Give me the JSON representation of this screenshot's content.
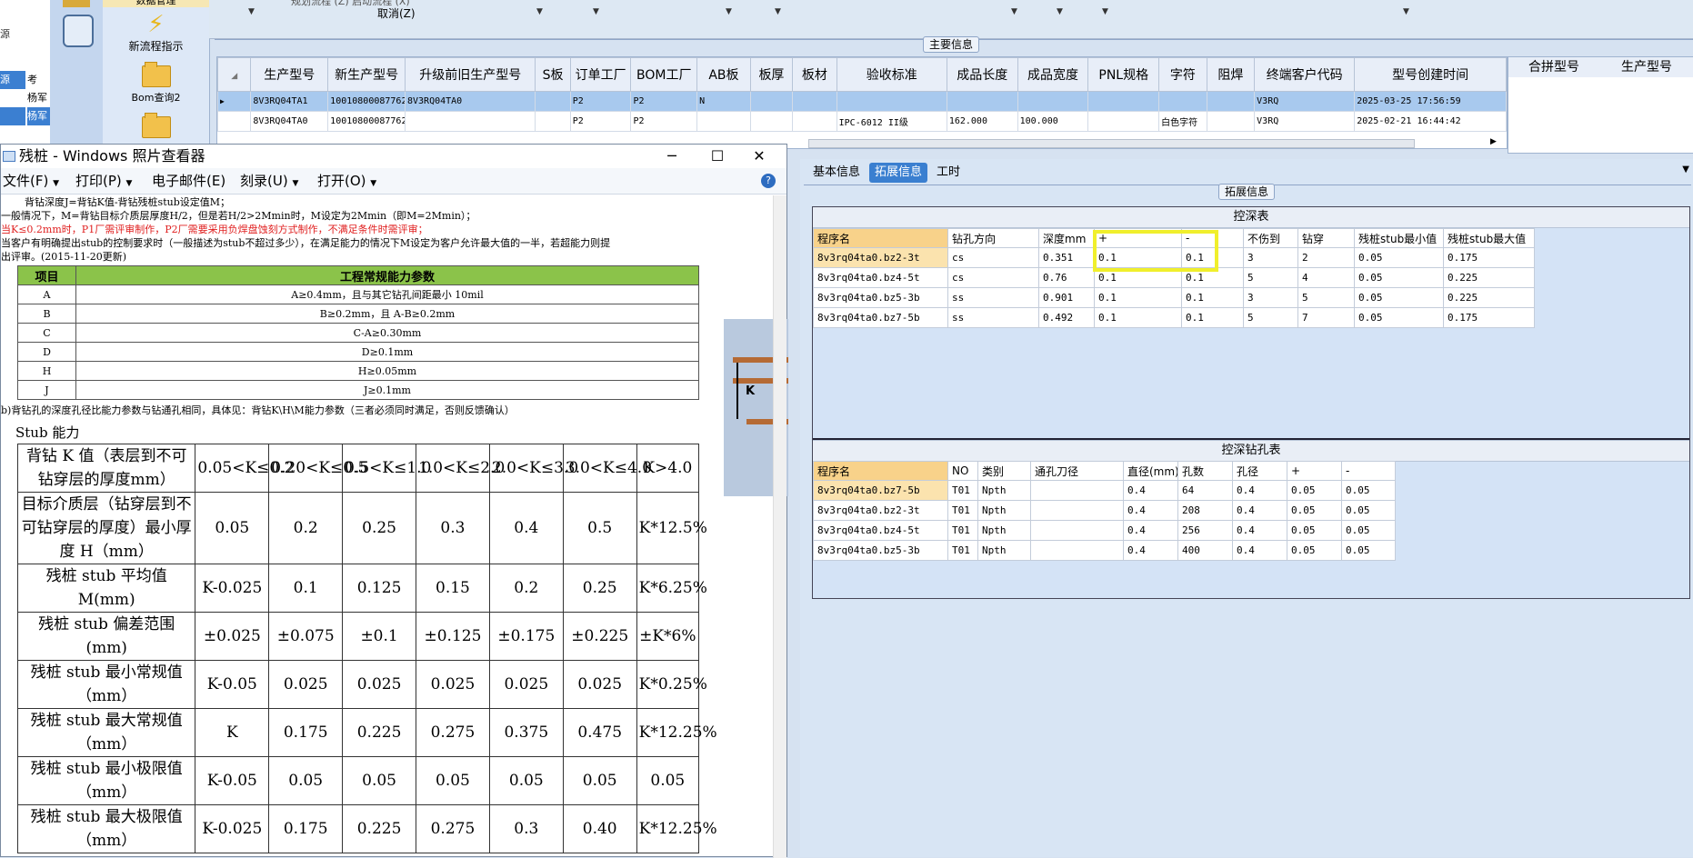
{
  "left_panel": {
    "rows": [
      "源",
      "考",
      "杨军",
      "杨军"
    ]
  },
  "launcher": {
    "items": [
      "数据管理",
      "新流程指示",
      "Bom查询2"
    ]
  },
  "topbar": {
    "cancel": "取消(Z)",
    "hidden_labels": "规划流程 (Z)    启动流程 (X)"
  },
  "main_info": {
    "group_title": "主要信息",
    "columns": [
      "生产型号",
      "新生产型号",
      "升级前旧生产型号",
      "S板",
      "订单工厂",
      "BOM工厂",
      "AB板",
      "板厚",
      "板材",
      "验收标准",
      "成品长度",
      "成品宽度",
      "PNL规格",
      "字符",
      "阻焊",
      "终端客户代码",
      "型号创建时间"
    ],
    "rows": [
      [
        "8V3RQ04TA1",
        "10010800087762",
        "8V3RQ04TA0",
        "",
        "P2",
        "P2",
        "N",
        "",
        "",
        "",
        "",
        "",
        "",
        "",
        "",
        "V3RQ",
        "2025-03-25 17:56:59"
      ],
      [
        "8V3RQ04TA0",
        "10010800087762",
        "",
        "",
        "P2",
        "P2",
        "",
        "",
        "",
        "IPC-6012 II级",
        "162.000",
        "100.000",
        "",
        "白色字符",
        "",
        "V3RQ",
        "2025-02-21 16:44:42"
      ]
    ],
    "side_columns": [
      "合拼型号",
      "生产型号"
    ]
  },
  "viewer": {
    "title": "残桩 - Windows 照片查看器",
    "menu": [
      "文件(F)",
      "打印(P)",
      "电子邮件(E)",
      "刻录(U)",
      "打开(O)"
    ],
    "notes": [
      "背钻深度J=背钻K值-背钻残桩stub设定值M；",
      "一般情况下，M=背钻目标介质层厚度H/2，但是若H/2>2Mmin时，M设定为2Mmin（即M=2Mmin）；",
      "当K≤0.2mm时，P1厂需评审制作，P2厂需要采用负焊盘蚀刻方式制作，不满足条件时需评审；",
      "当客户有明确提出stub的控制要求时（一般描述为stub不超过多少），在满足能力的情况下M设定为客户允许最大值的一半，若超能力则提",
      "出评审。(2015-11-20更新)"
    ],
    "param_table": {
      "headers": [
        "项目",
        "工程常规能力参数"
      ],
      "rows": [
        [
          "A",
          "A≥0.4mm，且与其它钻孔间距最小 10mil"
        ],
        [
          "B",
          "B≥0.2mm，且 A-B≥0.2mm"
        ],
        [
          "C",
          "C-A≥0.30mm"
        ],
        [
          "D",
          "D≥0.1mm"
        ],
        [
          "H",
          "H≥0.05mm"
        ],
        [
          "J",
          "J≥0.1mm"
        ]
      ]
    },
    "note_b": "b)背钻孔的深度孔径比能力参数与钻通孔相同，具体见：背钻K\\H\\M能力参数（三者必须同时满足，否则反馈确认）",
    "stub_title": "Stub 能力",
    "k_label": "K",
    "stub_table": [
      [
        "背钻 K 值（表层到不可钻穿层的厚度mm）",
        "0.05<K≤0.2",
        "0.20<K≤0.5",
        "0.5<K≤1.0",
        "1.0<K≤2.0",
        "2.0<K≤3.0",
        "3.0<K≤4.0",
        "K>4.0"
      ],
      [
        "目标介质层（钻穿层到不可钻穿层的厚度）最小厚度 H（mm）",
        "0.05",
        "0.2",
        "0.25",
        "0.3",
        "0.4",
        "0.5",
        "K*12.5%"
      ],
      [
        "残桩 stub 平均值 M(mm)",
        "K-0.025",
        "0.1",
        "0.125",
        "0.15",
        "0.2",
        "0.25",
        "K*6.25%"
      ],
      [
        "残桩 stub 偏差范围(mm)",
        "±0.025",
        "±0.075",
        "±0.1",
        "±0.125",
        "±0.175",
        "±0.225",
        "±K*6%"
      ],
      [
        "残桩 stub 最小常规值（mm）",
        "K-0.05",
        "0.025",
        "0.025",
        "0.025",
        "0.025",
        "0.025",
        "K*0.25%"
      ],
      [
        "残桩 stub 最大常规值（mm）",
        "K",
        "0.175",
        "0.225",
        "0.275",
        "0.375",
        "0.475",
        "K*12.25%"
      ],
      [
        "残桩 stub 最小极限值（mm）",
        "K-0.05",
        "0.05",
        "0.05",
        "0.05",
        "0.05",
        "0.05",
        "0.05"
      ],
      [
        "残桩 stub 最大极限值（mm）",
        "K-0.025",
        "0.175",
        "0.225",
        "0.275",
        "0.3",
        "0.40",
        "K*12.25%"
      ]
    ]
  },
  "tabs": [
    "基本信息",
    "拓展信息",
    "工时"
  ],
  "ext": {
    "group_title": "拓展信息",
    "depth_table": {
      "title": "控深表",
      "columns": [
        "程序名",
        "钻孔方向",
        "深度mm",
        "+",
        "-",
        "不伤到",
        "钻穿",
        "残桩stub最小值",
        "残桩stub最大值"
      ],
      "rows": [
        [
          "8v3rq04ta0.bz2-3t",
          "cs",
          "0.351",
          "0.1",
          "0.1",
          "3",
          "2",
          "0.05",
          "0.175"
        ],
        [
          "8v3rq04ta0.bz4-5t",
          "cs",
          "0.76",
          "0.1",
          "0.1",
          "5",
          "4",
          "0.05",
          "0.225"
        ],
        [
          "8v3rq04ta0.bz5-3b",
          "ss",
          "0.901",
          "0.1",
          "0.1",
          "3",
          "5",
          "0.05",
          "0.225"
        ],
        [
          "8v3rq04ta0.bz7-5b",
          "ss",
          "0.492",
          "0.1",
          "0.1",
          "5",
          "7",
          "0.05",
          "0.175"
        ]
      ]
    },
    "hole_table": {
      "title": "控深钻孔表",
      "columns": [
        "程序名",
        "NO",
        "类别",
        "通孔刀径",
        "直径(mm)",
        "孔数",
        "孔径",
        "+",
        "-"
      ],
      "rows": [
        [
          "8v3rq04ta0.bz7-5b",
          "T01",
          "Npth",
          "",
          "0.4",
          "64",
          "0.4",
          "0.05",
          "0.05"
        ],
        [
          "8v3rq04ta0.bz2-3t",
          "T01",
          "Npth",
          "",
          "0.4",
          "208",
          "0.4",
          "0.05",
          "0.05"
        ],
        [
          "8v3rq04ta0.bz4-5t",
          "T01",
          "Npth",
          "",
          "0.4",
          "256",
          "0.4",
          "0.05",
          "0.05"
        ],
        [
          "8v3rq04ta0.bz5-3b",
          "T01",
          "Npth",
          "",
          "0.4",
          "400",
          "0.4",
          "0.05",
          "0.05"
        ]
      ]
    }
  },
  "colors": {
    "highlight": "#f0ef2c",
    "tab_active": "#3a7fd0",
    "selected_row": "#a8c9ee",
    "param_header": "#8bc34a",
    "warning_text": "#e02020"
  }
}
